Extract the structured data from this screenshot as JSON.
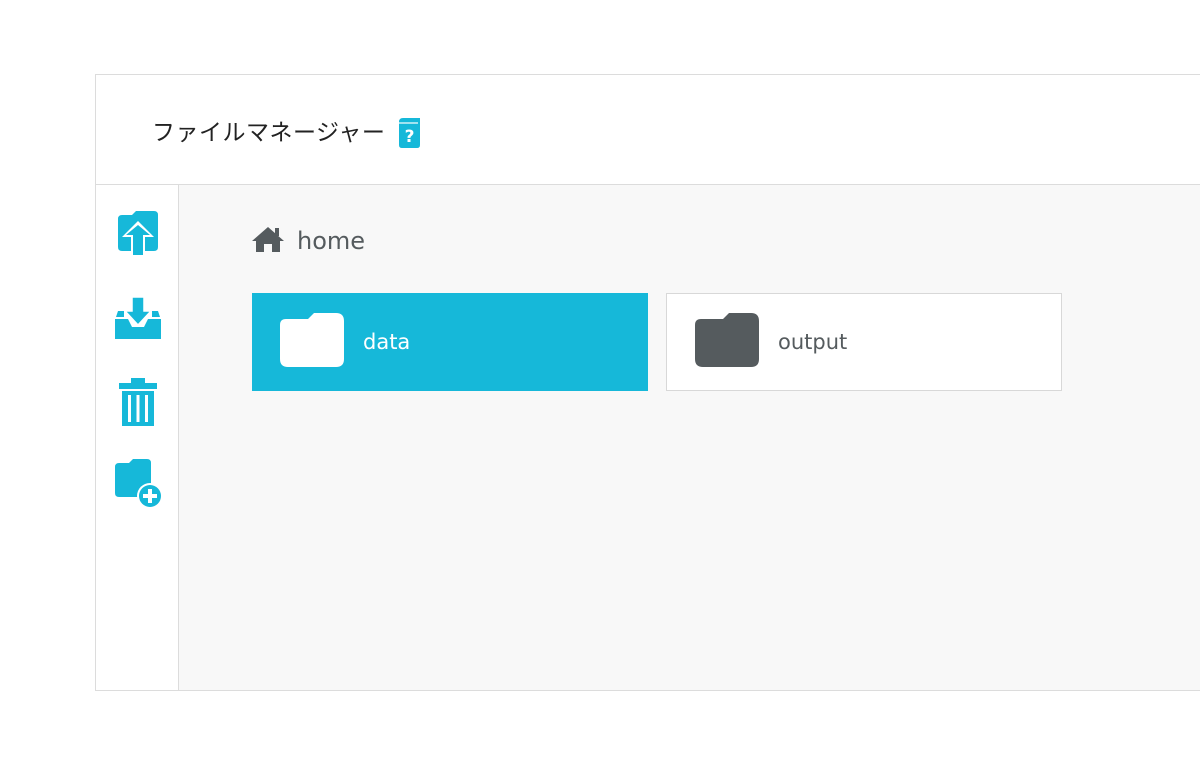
{
  "app": {
    "title": "ファイルマネージャー"
  },
  "icons": {
    "help": "help-book-icon",
    "upload": "upload-icon",
    "download": "download-tray-icon",
    "delete": "trash-icon",
    "new_folder": "folder-add-icon",
    "home": "home-icon",
    "folder": "folder-icon"
  },
  "breadcrumb": {
    "label": "home"
  },
  "folders": [
    {
      "label": "data",
      "selected": true
    },
    {
      "label": "output",
      "selected": false
    }
  ],
  "colors": {
    "accent": "#16b8d9",
    "dark_icon": "#555b5e",
    "panel_bg": "#f8f8f8",
    "border": "#dcdcdc"
  }
}
